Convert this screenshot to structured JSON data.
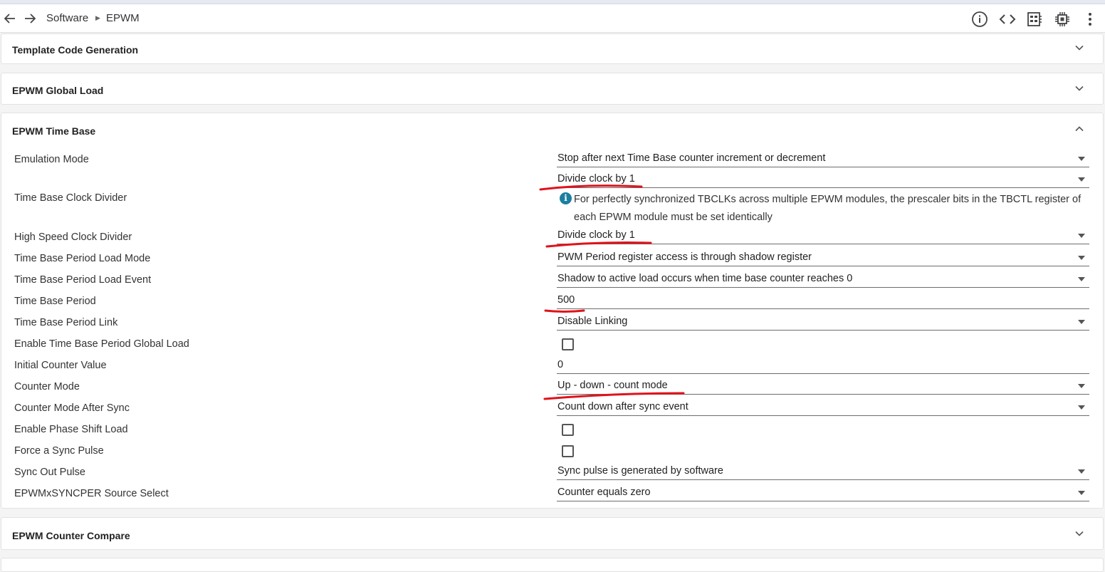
{
  "toolbar": {
    "back_icon": "arrow-left-icon",
    "forward_icon": "arrow-right-icon",
    "breadcrumb": [
      "Software",
      "EPWM"
    ],
    "icons": [
      "info-icon",
      "code-icon",
      "memory-icon",
      "chip-icon",
      "more-vert-icon"
    ]
  },
  "panels": {
    "template": {
      "title": "Template Code Generation"
    },
    "global_load": {
      "title": "EPWM Global Load"
    },
    "time_base": {
      "title": "EPWM Time Base"
    },
    "counter_compare": {
      "title": "EPWM Counter Compare"
    }
  },
  "fields": {
    "emulation_mode": {
      "label": "Emulation Mode",
      "value": "Stop after next Time Base counter increment or decrement"
    },
    "tb_clock_divider": {
      "label": "Time Base Clock Divider",
      "value": "Divide clock by 1",
      "info": "For perfectly synchronized TBCLKs across multiple EPWM modules, the prescaler bits in the TBCTL register of each EPWM module must be set identically"
    },
    "hs_clock_divider": {
      "label": "High Speed Clock Divider",
      "value": "Divide clock by 1"
    },
    "period_load_mode": {
      "label": "Time Base Period Load Mode",
      "value": "PWM Period register access is through shadow register"
    },
    "period_load_event": {
      "label": "Time Base Period Load Event",
      "value": "Shadow to active load occurs when time base counter reaches 0"
    },
    "period": {
      "label": "Time Base Period",
      "value": "500"
    },
    "period_link": {
      "label": "Time Base Period Link",
      "value": "Disable Linking"
    },
    "period_global_load": {
      "label": "Enable Time Base Period Global Load",
      "checked": false
    },
    "initial_counter": {
      "label": "Initial Counter Value",
      "value": "0"
    },
    "counter_mode": {
      "label": "Counter Mode",
      "value": "Up - down - count mode"
    },
    "counter_mode_after_sync": {
      "label": "Counter Mode After Sync",
      "value": "Count down after sync event"
    },
    "phase_shift_load": {
      "label": "Enable Phase Shift Load",
      "checked": false
    },
    "force_sync": {
      "label": "Force a Sync Pulse",
      "checked": false
    },
    "sync_out": {
      "label": "Sync Out Pulse",
      "value": "Sync pulse is generated by software"
    },
    "syncper_source": {
      "label": "EPWMxSYNCPER Source Select",
      "value": "Counter equals zero"
    }
  },
  "colors": {
    "annotation": "#e0121b",
    "info": "#1b7fa0"
  }
}
